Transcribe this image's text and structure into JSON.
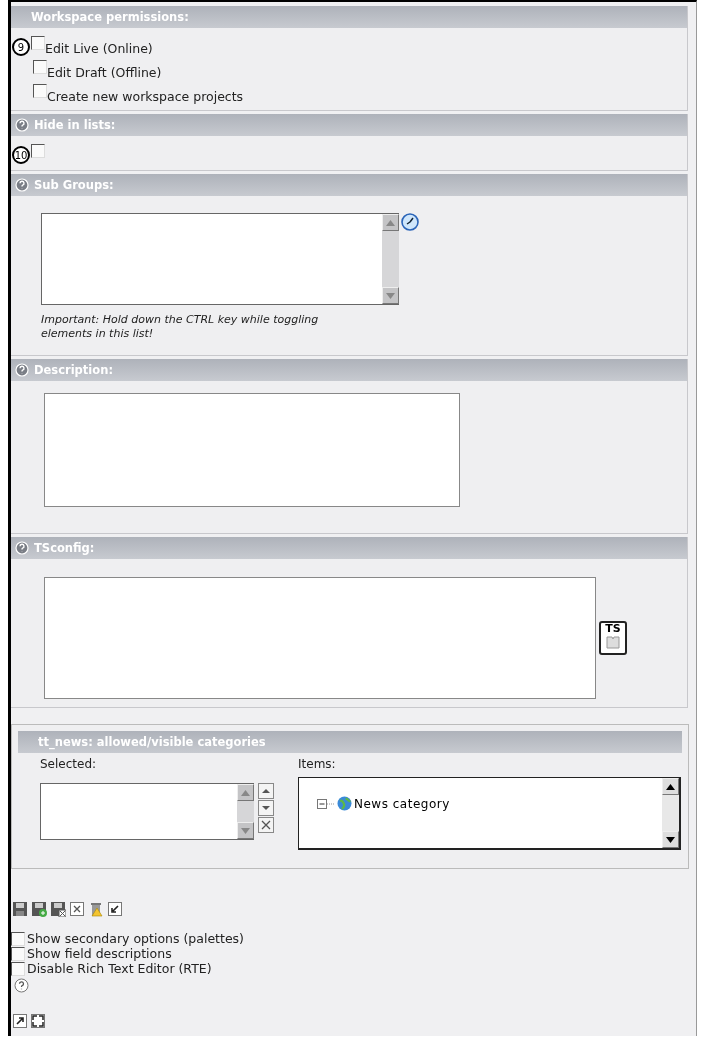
{
  "sections": [
    {
      "kind": "checkboxes",
      "title": "Workspace permissions:",
      "help": false,
      "marker": "9",
      "options": [
        {
          "label": "Edit Live (Online)",
          "checked": false
        },
        {
          "label": "Edit Draft (Offline)",
          "checked": false
        },
        {
          "label": "Create new workspace projects",
          "checked": false
        }
      ]
    },
    {
      "kind": "checkboxes",
      "title": "Hide in lists:",
      "help": true,
      "marker": "10",
      "options": [
        {
          "checked": false
        }
      ]
    },
    {
      "kind": "multiselect",
      "title": "Sub Groups:",
      "help": true,
      "note": "Important: Hold down the CTRL key while toggling elements in this list!"
    },
    {
      "kind": "textarea",
      "title": "Description:",
      "help": true
    },
    {
      "kind": "textarea",
      "title": "TSconfig:",
      "help": true,
      "badge": "TS"
    }
  ],
  "categories": {
    "title": "tt_news: allowed/visible categories",
    "selected_label": "Selected:",
    "items_label": "Items:",
    "items": [
      {
        "label": "News category",
        "expanded": true
      }
    ]
  },
  "options": [
    {
      "label": "Show secondary options (palettes)",
      "checked": false
    },
    {
      "label": "Show field descriptions",
      "checked": false
    },
    {
      "label": "Disable Rich Text Editor (RTE)",
      "checked": false
    }
  ]
}
